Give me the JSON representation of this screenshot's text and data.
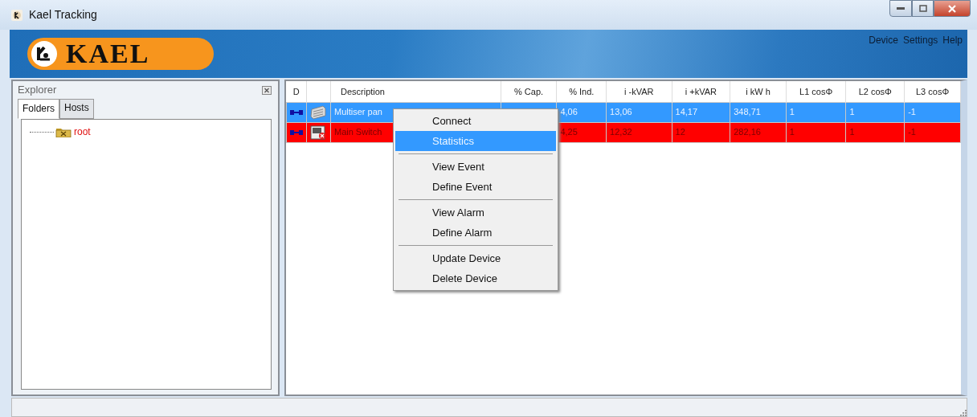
{
  "window": {
    "title": "Kael Tracking"
  },
  "banner": {
    "logo_text": "KAEL"
  },
  "menu_bar": [
    "Device",
    "Settings",
    "Help"
  ],
  "explorer": {
    "title": "Explorer",
    "tabs": [
      {
        "label": "Folders",
        "selected": true
      },
      {
        "label": "Hosts",
        "selected": false
      }
    ],
    "tree": [
      {
        "label": "root"
      }
    ]
  },
  "table": {
    "columns": [
      "D",
      "",
      "Description",
      "% Cap.",
      "% Ind.",
      "i -kVAR",
      "i +kVAR",
      "i kW h",
      "L1 cosΦ",
      "L2 cosΦ",
      "L3 cosΦ"
    ],
    "rows": [
      {
        "selected": true,
        "alarm": false,
        "kind": "panel",
        "description": "Multiser pan",
        "ind": "4,06",
        "minus_kvar": "13,06",
        "plus_kvar": "14,17",
        "kwh": "348,71",
        "l1": "1",
        "l2": "1",
        "l3": "-1"
      },
      {
        "selected": false,
        "alarm": true,
        "kind": "switch-error",
        "description": "Main Switch",
        "ind": "4,25",
        "minus_kvar": "12,32",
        "plus_kvar": "12",
        "kwh": "282,16",
        "l1": "1",
        "l2": "1",
        "l3": "-1"
      }
    ]
  },
  "context_menu": [
    {
      "kind": "item",
      "label": "Connect",
      "selected": false
    },
    {
      "kind": "item",
      "label": "Statistics",
      "selected": true
    },
    {
      "kind": "separator"
    },
    {
      "kind": "item",
      "label": "View Event",
      "selected": false
    },
    {
      "kind": "item",
      "label": "Define Event",
      "selected": false
    },
    {
      "kind": "separator"
    },
    {
      "kind": "item",
      "label": "View Alarm",
      "selected": false
    },
    {
      "kind": "item",
      "label": "Define Alarm",
      "selected": false
    },
    {
      "kind": "separator"
    },
    {
      "kind": "item",
      "label": "Update Device",
      "selected": false
    },
    {
      "kind": "item",
      "label": "Delete Device",
      "selected": false
    }
  ]
}
